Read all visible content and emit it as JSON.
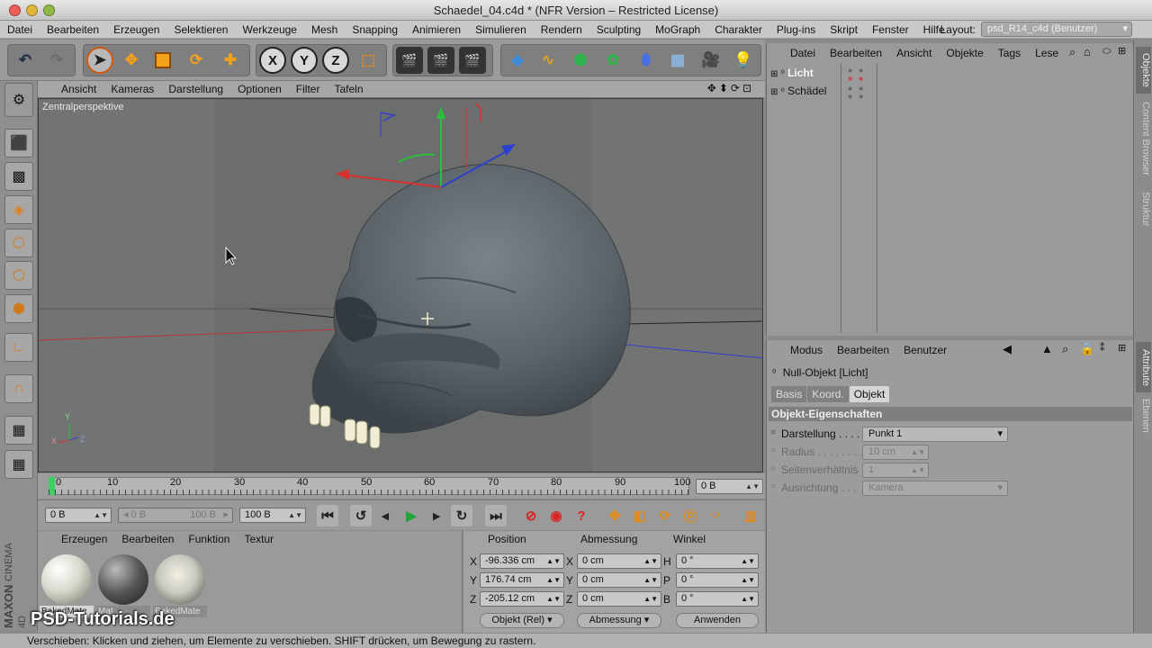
{
  "window": {
    "title": "Schaedel_04.c4d * (NFR Version – Restricted License)"
  },
  "menu": [
    "Datei",
    "Bearbeiten",
    "Erzeugen",
    "Selektieren",
    "Werkzeuge",
    "Mesh",
    "Snapping",
    "Animieren",
    "Simulieren",
    "Rendern",
    "Sculpting",
    "MoGraph",
    "Charakter",
    "Plug-ins",
    "Skript",
    "Fenster",
    "Hilfe"
  ],
  "layout": {
    "label": "Layout:",
    "value": "psd_R14_c4d (Benutzer)"
  },
  "viewport": {
    "menu": [
      "Ansicht",
      "Kameras",
      "Darstellung",
      "Optionen",
      "Filter",
      "Tafeln"
    ],
    "camera_label": "Zentralperspektive",
    "axis": {
      "y": "Y",
      "x": "X",
      "z": "Z"
    }
  },
  "timeline": {
    "ticks": [
      "0",
      "10",
      "20",
      "30",
      "40",
      "50",
      "60",
      "70",
      "80",
      "90",
      "100"
    ],
    "current_frame": "0 B"
  },
  "transport": {
    "start": "0 B",
    "range_left": "0 B",
    "range_right": "100 B",
    "end": "100 B"
  },
  "materials": {
    "menu": [
      "Erzeugen",
      "Bearbeiten",
      "Funktion",
      "Textur"
    ],
    "items": [
      {
        "name": "BakedMate",
        "color": "#d8d8cc"
      },
      {
        "name": "Mat",
        "color": "#555555"
      },
      {
        "name": "BakedMate",
        "color": "#c9c9bf"
      }
    ]
  },
  "coords": {
    "headers": [
      "Position",
      "Abmessung",
      "Winkel"
    ],
    "rows": [
      {
        "axis": "X",
        "pos": "-96.336 cm",
        "size_axis": "X",
        "size": "0 cm",
        "rot_axis": "H",
        "rot": "0 °"
      },
      {
        "axis": "Y",
        "pos": "176.74 cm",
        "size_axis": "Y",
        "size": "0 cm",
        "rot_axis": "P",
        "rot": "0 °"
      },
      {
        "axis": "Z",
        "pos": "-205.12 cm",
        "size_axis": "Z",
        "size": "0 cm",
        "rot_axis": "B",
        "rot": "0 °"
      }
    ],
    "mode": "Objekt (Rel)",
    "size_mode": "Abmessung",
    "apply": "Anwenden"
  },
  "objects": {
    "menu": [
      "Datei",
      "Bearbeiten",
      "Ansicht",
      "Objekte",
      "Tags",
      "Lese"
    ],
    "items": [
      {
        "name": "Licht",
        "selected": true
      },
      {
        "name": "Schädel",
        "selected": false
      }
    ]
  },
  "attributes": {
    "menu": [
      "Modus",
      "Bearbeiten",
      "Benutzer"
    ],
    "object_title": "Null-Objekt [Licht]",
    "tabs": [
      "Basis",
      "Koord.",
      "Objekt"
    ],
    "active_tab": "Objekt",
    "section": "Objekt-Eigenschaften",
    "props": [
      {
        "label": "Darstellung . . . .",
        "value": "Punkt 1",
        "enabled": true
      },
      {
        "label": "Radius . . . . . . . .",
        "value": "10 cm",
        "enabled": false
      },
      {
        "label": "Seitenverhältnis",
        "value": "1",
        "enabled": false
      },
      {
        "label": "Ausrichtung . . .",
        "value": "Kamera",
        "enabled": false
      }
    ]
  },
  "right_tabs": [
    "Objekte",
    "Content Browser",
    "Struktur",
    "Attribute",
    "Ebenen"
  ],
  "branding": {
    "maxon": "MAXON",
    "cinema": "CINEMA 4D",
    "watermark": "PSD-Tutorials.de"
  },
  "status": "Verschieben: Klicken und ziehen, um Elemente zu verschieben. SHIFT drücken, um Bewegung zu rastern."
}
